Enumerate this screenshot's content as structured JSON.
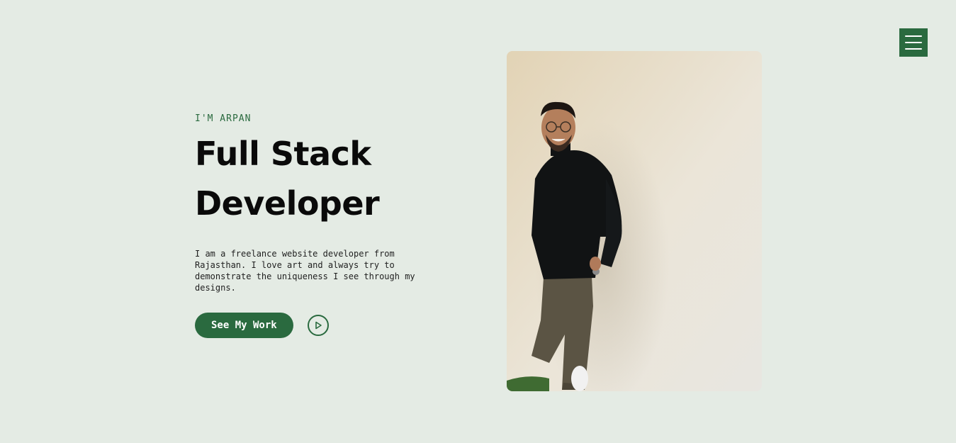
{
  "nav": {
    "menu_icon": "hamburger-icon",
    "accent_color": "#2a6a3f"
  },
  "hero": {
    "eyebrow": "I'M ARPAN",
    "headline_line1": "Full Stack",
    "headline_line2": "Developer",
    "description": "I am a freelance website developer from Rajasthan. I love art and always try to demonstrate the uniqueness I see through my designs.",
    "cta_label": "See My Work",
    "play_icon": "play-icon",
    "portrait_icon": "portrait-photo"
  },
  "colors": {
    "background": "#e4ebe4",
    "accent": "#2a6a3f",
    "text": "#0a0a0a"
  }
}
